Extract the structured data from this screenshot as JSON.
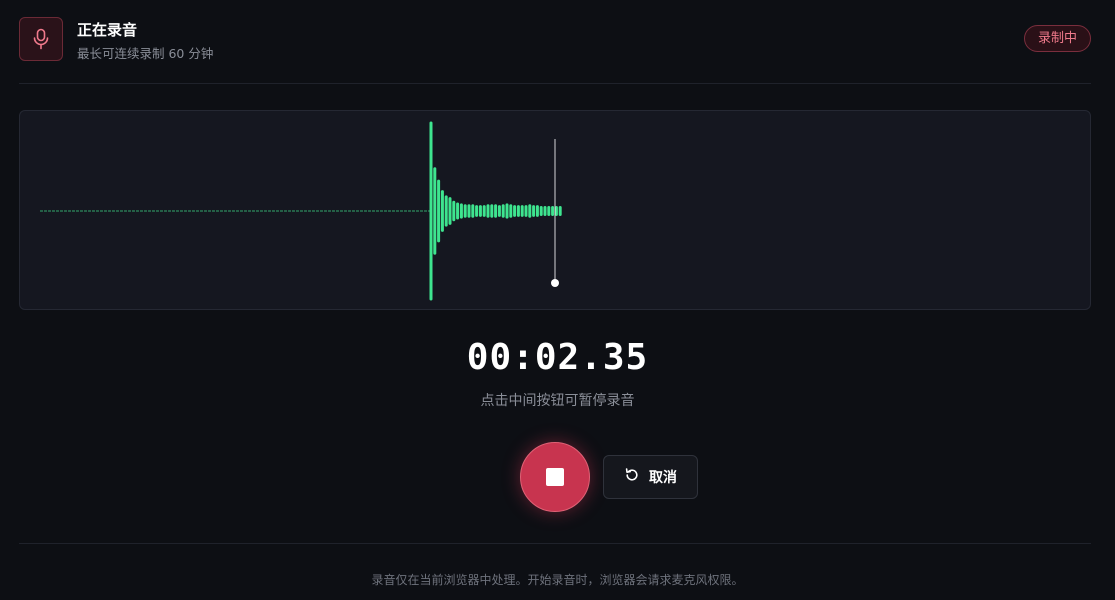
{
  "header": {
    "icon": "microphone-icon",
    "title": "正在录音",
    "subtitle": "最长可连续录制 60 分钟",
    "badge": "录制中"
  },
  "waveform": {
    "wave_color": "#3ee58f",
    "playhead_color": "#ffffff",
    "amplitudes": [
      1.0,
      0.48,
      0.34,
      0.22,
      0.16,
      0.14,
      0.1,
      0.08,
      0.07,
      0.06,
      0.06,
      0.06,
      0.05,
      0.05,
      0.05,
      0.06,
      0.06,
      0.06,
      0.05,
      0.06,
      0.07,
      0.06,
      0.05,
      0.05,
      0.05,
      0.05,
      0.06,
      0.05,
      0.05,
      0.04,
      0.04,
      0.04,
      0.04,
      0.04,
      0.04
    ]
  },
  "timer": {
    "value": "00:02.35"
  },
  "hint": "点击中间按钮可暂停录音",
  "controls": {
    "stop_icon": "stop-icon",
    "cancel_icon": "undo-icon",
    "cancel_label": "取消"
  },
  "footer": "录音仅在当前浏览器中处理。开始录音时，浏览器会请求麦克风权限。",
  "colors": {
    "accent": "#c8344f",
    "badge_text": "#f07a8c",
    "background": "#0d0f14",
    "panel": "#151720"
  }
}
